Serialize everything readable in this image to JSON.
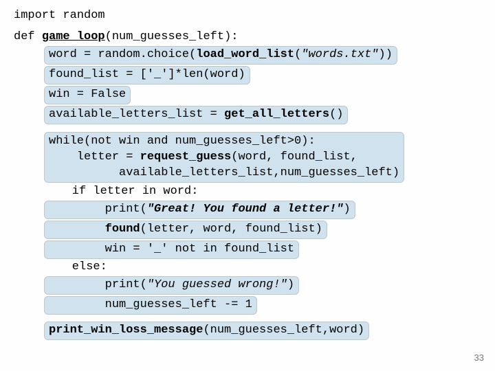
{
  "code": {
    "l1": "import random",
    "l2_pre": "def ",
    "l2_fn": "game_loop",
    "l2_post": "(num_guesses_left):",
    "l3_a": "word = random.choice(",
    "l3_b": "load_word_list",
    "l3_c": "(",
    "l3_d": "\"words.txt\"",
    "l3_e": "))",
    "l4": "found_list = ['_']*len(word)",
    "l5": "win = False",
    "l6_a": "available_letters_list = ",
    "l6_b": "get_all_letters",
    "l6_c": "()",
    "l7": "while(not win and num_guesses_left>0):",
    "l8_a": "    letter = ",
    "l8_b": "request_guess",
    "l8_c": "(word, found_list,",
    "l9": "          available_letters_list,num_guesses_left)",
    "l10": "    if letter in word:",
    "l11_a": "        print(",
    "l11_b": "\"Great! You found a letter!\"",
    "l11_c": ")",
    "l12_a": "        ",
    "l12_b": "found",
    "l12_c": "(letter, word, found_list)",
    "l13": "        win = '_' not in found_list",
    "l14": "    else:",
    "l15_a": "        print(",
    "l15_b": "\"You guessed wrong!\"",
    "l15_c": ")",
    "l16": "        num_guesses_left -= 1",
    "l17_a": "print_win_loss_message",
    "l17_b": "(num_guesses_left,word)"
  },
  "page_number": "33"
}
